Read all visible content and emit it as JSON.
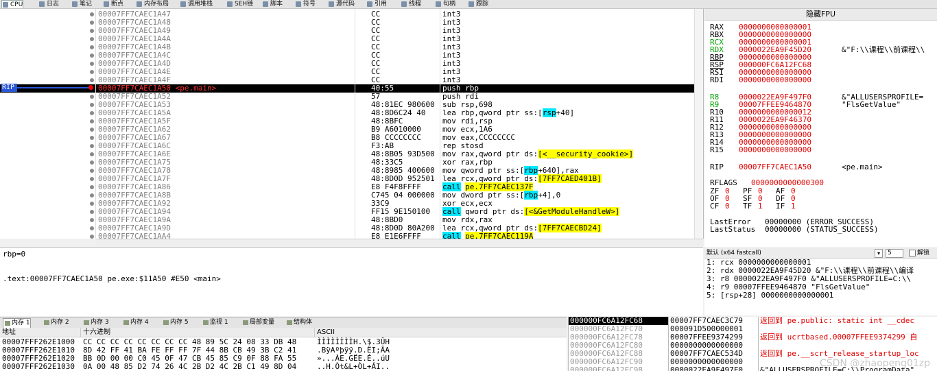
{
  "tabs": [
    {
      "label": "CPU",
      "active": true
    },
    {
      "label": "日志"
    },
    {
      "label": "笔记"
    },
    {
      "label": "断点"
    },
    {
      "label": "内存布局"
    },
    {
      "label": "调用堆栈"
    },
    {
      "label": "SEH链"
    },
    {
      "label": "脚本"
    },
    {
      "label": "符号"
    },
    {
      "label": "源代码"
    },
    {
      "label": "引用"
    },
    {
      "label": "线程"
    },
    {
      "label": "句柄"
    },
    {
      "label": "跟踪"
    }
  ],
  "disasm": {
    "rip_label": "RIP",
    "rows": [
      {
        "addr": "00007FF7CAEC1A47",
        "bytes": "CC",
        "instr": "int3"
      },
      {
        "addr": "00007FF7CAEC1A48",
        "bytes": "CC",
        "instr": "int3"
      },
      {
        "addr": "00007FF7CAEC1A49",
        "bytes": "CC",
        "instr": "int3"
      },
      {
        "addr": "00007FF7CAEC1A4A",
        "bytes": "CC",
        "instr": "int3"
      },
      {
        "addr": "00007FF7CAEC1A4B",
        "bytes": "CC",
        "instr": "int3"
      },
      {
        "addr": "00007FF7CAEC1A4C",
        "bytes": "CC",
        "instr": "int3"
      },
      {
        "addr": "00007FF7CAEC1A4D",
        "bytes": "CC",
        "instr": "int3"
      },
      {
        "addr": "00007FF7CAEC1A4E",
        "bytes": "CC",
        "instr": "int3"
      },
      {
        "addr": "00007FF7CAEC1A4F",
        "bytes": "CC",
        "instr": "int3"
      },
      {
        "addr": "00007FF7CAEC1A50 <pe.main>",
        "bytes": "40:55",
        "instr": "push rbp",
        "selected": true
      },
      {
        "addr": "00007FF7CAEC1A52",
        "bytes": "57",
        "instr": "push rdi"
      },
      {
        "addr": "00007FF7CAEC1A53",
        "bytes": "48:81EC 980600",
        "instr": "sub rsp,698"
      },
      {
        "addr": "00007FF7CAEC1A5A",
        "bytes": "48:8D6C24 40",
        "instr": "lea rbp,qword ptr ss:[rsp+40]"
      },
      {
        "addr": "00007FF7CAEC1A5F",
        "bytes": "48:8BFC",
        "instr": "mov rdi,rsp"
      },
      {
        "addr": "00007FF7CAEC1A62",
        "bytes": "B9 A6010000",
        "instr": "mov ecx,1A6"
      },
      {
        "addr": "00007FF7CAEC1A67",
        "bytes": "B8 CCCCCCCC",
        "instr": "mov eax,CCCCCCCC"
      },
      {
        "addr": "00007FF7CAEC1A6C",
        "bytes": "F3:AB",
        "instr": "rep stosd"
      },
      {
        "addr": "00007FF7CAEC1A6E",
        "bytes": "48:8B05 93D500",
        "instr": "mov rax,qword ptr ds:[<__security_cookie>]"
      },
      {
        "addr": "00007FF7CAEC1A75",
        "bytes": "48:33C5",
        "instr": "xor rax,rbp"
      },
      {
        "addr": "00007FF7CAEC1A78",
        "bytes": "48:8985 400600",
        "instr": "mov qword ptr ss:[rbp+640],rax"
      },
      {
        "addr": "00007FF7CAEC1A7F",
        "bytes": "48:8D0D 952501",
        "instr": "lea rcx,qword ptr ds:[7FF7CAED401B]"
      },
      {
        "addr": "00007FF7CAEC1A86",
        "bytes": "E8 F4F8FFFF",
        "instr": "call pe.7FF7CAEC137F"
      },
      {
        "addr": "00007FF7CAEC1A8B",
        "bytes": "C745 04 000000",
        "instr": "mov dword ptr ss:[rbp+4],0"
      },
      {
        "addr": "00007FF7CAEC1A92",
        "bytes": "33C9",
        "instr": "xor ecx,ecx"
      },
      {
        "addr": "00007FF7CAEC1A94",
        "bytes": "FF15 9E150100",
        "instr": "call qword ptr ds:[<&GetModuleHandleW>]"
      },
      {
        "addr": "00007FF7CAEC1A9A",
        "bytes": "48:8BD0",
        "instr": "mov rdx,rax"
      },
      {
        "addr": "00007FF7CAEC1A9D",
        "bytes": "48:8D0D 80A200",
        "instr": "lea rcx,qword ptr ds:[7FF7CAECBD24]"
      },
      {
        "addr": "00007FF7CAEC1AA4",
        "bytes": "E8 E1E6FFFF",
        "instr": "call pe.7FF7CAEC119A"
      }
    ]
  },
  "registers": {
    "header": "隐藏FPU",
    "gp": [
      {
        "name": "RAX",
        "value": "0000000000000001",
        "comment": ""
      },
      {
        "name": "RBX",
        "value": "0000000000000000",
        "comment": ""
      },
      {
        "name": "RCX",
        "value": "0000000000000001",
        "comment": "",
        "green": true
      },
      {
        "name": "RDX",
        "value": "0000022EA9F45D20",
        "comment": "&\"F:\\\\课程\\\\前课程\\\\",
        "green": true
      },
      {
        "name": "RBP",
        "value": "0000000000000000",
        "comment": "",
        "ul": true
      },
      {
        "name": "RSP",
        "value": "000000FC6A12FC68",
        "comment": "",
        "ul": true
      },
      {
        "name": "RSI",
        "value": "0000000000000000",
        "comment": ""
      },
      {
        "name": "RDI",
        "value": "0000000000000000",
        "comment": ""
      }
    ],
    "ext": [
      {
        "name": "R8",
        "value": "0000022EA9F497F0",
        "comment": "&\"ALLUSERSPROFILE=",
        "green": true
      },
      {
        "name": "R9",
        "value": "00007FFEE9464870",
        "comment": "\"FlsGetValue\"",
        "green": true
      },
      {
        "name": "R10",
        "value": "0000000000000012",
        "comment": ""
      },
      {
        "name": "R11",
        "value": "0000022EA9F46370",
        "comment": ""
      },
      {
        "name": "R12",
        "value": "0000000000000000",
        "comment": ""
      },
      {
        "name": "R13",
        "value": "0000000000000000",
        "comment": ""
      },
      {
        "name": "R14",
        "value": "0000000000000000",
        "comment": ""
      },
      {
        "name": "R15",
        "value": "0000000000000000",
        "comment": ""
      }
    ],
    "rip": {
      "name": "RIP",
      "value": "00007FF7CAEC1A50",
      "comment": "<pe.main>"
    },
    "rflags": {
      "name": "RFLAGS",
      "value": "0000000000000300"
    },
    "flags": [
      [
        "ZF",
        "0",
        "PF",
        "0",
        "AF",
        "0"
      ],
      [
        "OF",
        "0",
        "SF",
        "0",
        "DF",
        "0"
      ],
      [
        "CF",
        "0",
        "TF",
        "1",
        "IF",
        "1"
      ]
    ],
    "last_error": {
      "name": "LastError",
      "value": "00000000 (ERROR_SUCCESS)"
    },
    "last_status": {
      "name": "LastStatus",
      "value": "00000000 (STATUS_SUCCESS)"
    }
  },
  "info": {
    "line1": "rbp=0",
    "line2": ".text:00007FF7CAEC1A50 pe.exe:$11A50 #E50 <main>"
  },
  "args": {
    "convention": "默认 (x64 fastcall)",
    "count": "5",
    "unlock": "解锁",
    "lines": [
      "1: rcx 0000000000000001",
      "2: rdx 0000022EA9F45D20 &\"F:\\\\课程\\\\前课程\\\\编译",
      "3: r8 0000022EA9F497F0 &\"ALLUSERSPROFILE=C:\\\\",
      "4: r9 00007FFEE9464870 \"FlsGetValue\"",
      "5: [rsp+28] 0000000000000001"
    ]
  },
  "bottom_tabs": [
    {
      "label": "内存 1",
      "active": true
    },
    {
      "label": "内存 2"
    },
    {
      "label": "内存 3"
    },
    {
      "label": "内存 4"
    },
    {
      "label": "内存 5"
    },
    {
      "label": "监视 1"
    },
    {
      "label": "局部变量"
    },
    {
      "label": "结构体"
    }
  ],
  "dump": {
    "col_addr": "地址",
    "col_hex": "十六进制",
    "col_ascii": "ASCII",
    "rows": [
      {
        "addr": "00007FFF262E1000",
        "hex": "CC CC CC CC CC CC CC CC 48 89 5C 24 08 33 DB 48",
        "ascii": "ÌÌÌÌÌÌÌÌH.\\$.3ÛH"
      },
      {
        "addr": "00007FFF262E1010",
        "hex": "8D 42 FF 41 BA FE FF FF 7F 44 8B CB 49 3B C2 41",
        "ascii": ".BÿAºþÿÿ.D.ËI;ÂA"
      },
      {
        "addr": "00007FFF262E1020",
        "hex": "BB 0D 00 00 C0 45 0F 47 CB 45 85 C9 0F 88 FA 55",
        "ascii": "»...ÀE.GËE.É..úU"
      },
      {
        "addr": "00007FFF262E1030",
        "hex": "0A 00 48 85 D2 74 26 4C 2B D2 4C 2B C1 49 8D 04",
        "ascii": "..H.Òt&L+ÒL+ÁI.."
      }
    ]
  },
  "stack": {
    "addrs": [
      "000000FC6A12FC68",
      "000000FC6A12FC70",
      "000000FC6A12FC78",
      "000000FC6A12FC80",
      "000000FC6A12FC88",
      "000000FC6A12FC90",
      "000000FC6A12FC98"
    ],
    "values": [
      "00007FF7CAEC3C79",
      "000091D500000001",
      "00007FFEE9374299",
      "0000000000000000",
      "00007FF7CAEC534D",
      "0000000000000000",
      "0000022EA9F497F0"
    ],
    "comments": [
      "返回到 pe.public: static int __cdec",
      "",
      "返回到 ucrtbased.00007FFEE9374299 自",
      "",
      "返回到 pe.__scrt_release_startup_loc",
      "",
      "&\"ALLUSERSPROFILE=C:\\\\ProgramData\""
    ]
  },
  "watermark": "CSDN @zhaopeng01zp"
}
